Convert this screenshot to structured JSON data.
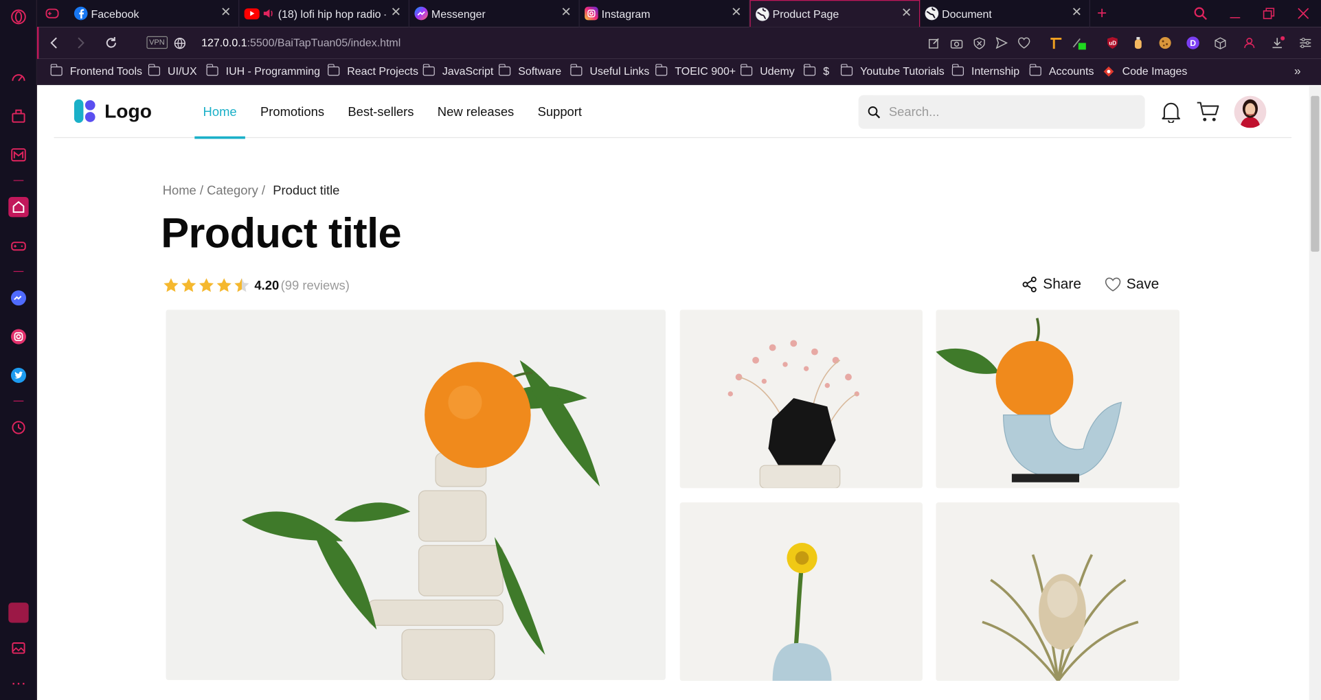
{
  "tabs": [
    {
      "title": "Facebook"
    },
    {
      "title": "(18) lofi hip hop radio -"
    },
    {
      "title": "Messenger"
    },
    {
      "title": "Instagram"
    },
    {
      "title": "Product Page"
    },
    {
      "title": "Document"
    }
  ],
  "browser": {
    "vpn_label": "VPN",
    "url_host": "127.0.0.1",
    "url_path": ":5500/BaiTapTuan05/index.html",
    "accent_color": "#e0245e"
  },
  "bookmarks": [
    "Frontend Tools",
    "UI/UX",
    "IUH - Programming",
    "React Projects",
    "JavaScript",
    "Software",
    "Useful Links",
    "TOEIC 900+",
    "Udemy",
    "$",
    "Youtube Tutorials",
    "Internship",
    "Accounts",
    "Code Images"
  ],
  "site": {
    "logo_text": "Logo",
    "nav": [
      "Home",
      "Promotions",
      "Best-sellers",
      "New releases",
      "Support"
    ],
    "active_nav": "Home",
    "search_placeholder": "Search...",
    "accent_color": "#1ab0c8"
  },
  "product": {
    "breadcrumb": [
      "Home",
      "Category",
      "Product title"
    ],
    "title": "Product title",
    "rating": "4.20",
    "rating_value": 4.2,
    "rating_max": 5,
    "reviews_text": "(99 reviews)",
    "share_label": "Share",
    "save_label": "Save",
    "star_color": "#f5b82e"
  }
}
